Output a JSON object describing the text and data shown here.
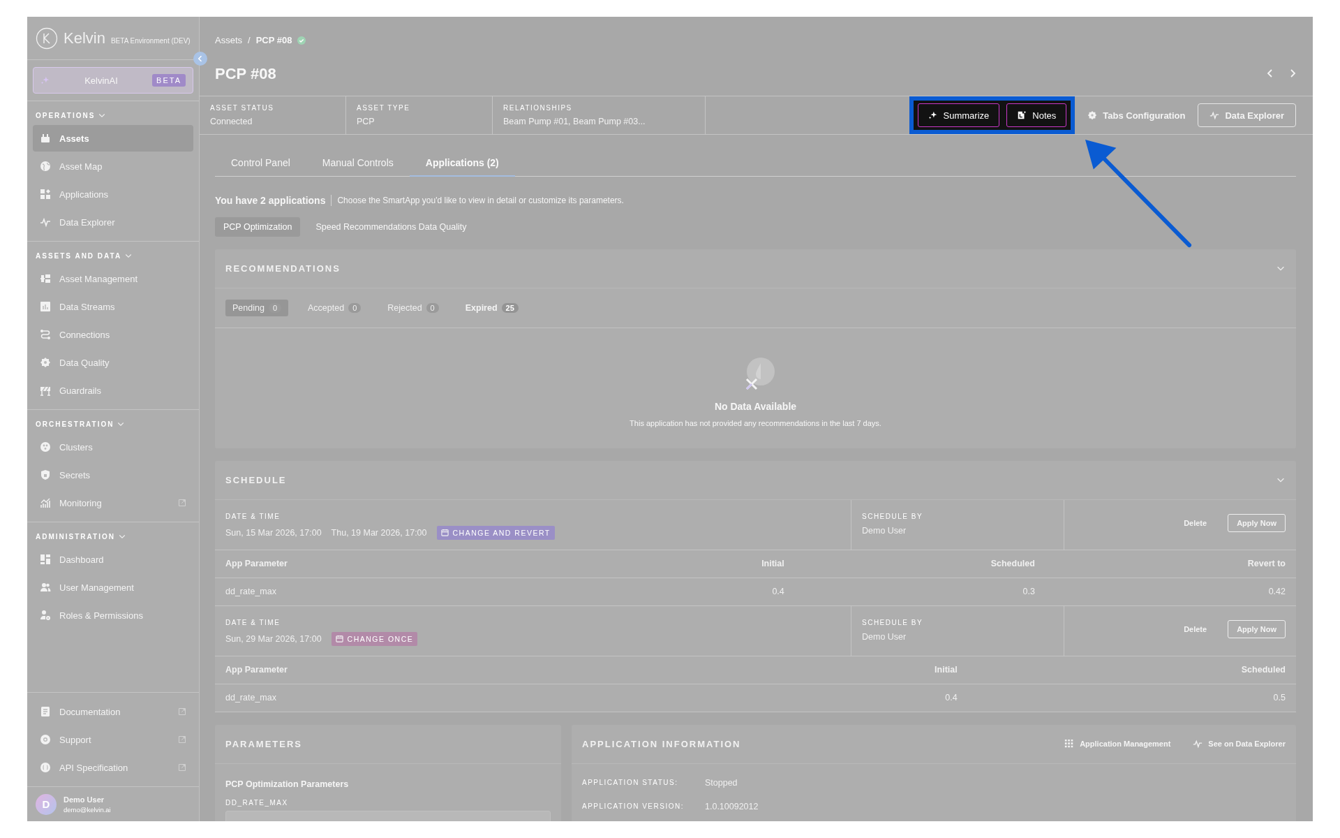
{
  "sidebar": {
    "logo": "Kelvin",
    "environment": "BETA Environment (DEV)",
    "ai_button": {
      "label": "KelvinAI",
      "badge": "BETA"
    },
    "sections": [
      {
        "title": "OPERATIONS",
        "expanded": true,
        "items": [
          {
            "label": "Assets",
            "selected": true,
            "external": false
          },
          {
            "label": "Asset Map",
            "selected": false,
            "external": false
          },
          {
            "label": "Applications",
            "selected": false,
            "external": false
          },
          {
            "label": "Data Explorer",
            "selected": false,
            "external": false
          }
        ]
      },
      {
        "title": "ASSETS AND DATA",
        "expanded": true,
        "items": [
          {
            "label": "Asset Management",
            "selected": false,
            "external": false
          },
          {
            "label": "Data Streams",
            "selected": false,
            "external": false
          },
          {
            "label": "Connections",
            "selected": false,
            "external": false
          },
          {
            "label": "Data Quality",
            "selected": false,
            "external": false
          },
          {
            "label": "Guardrails",
            "selected": false,
            "external": false
          }
        ]
      },
      {
        "title": "ORCHESTRATION",
        "expanded": true,
        "items": [
          {
            "label": "Clusters",
            "selected": false,
            "external": false
          },
          {
            "label": "Secrets",
            "selected": false,
            "external": false
          },
          {
            "label": "Monitoring",
            "selected": false,
            "external": true
          }
        ]
      },
      {
        "title": "ADMINISTRATION",
        "expanded": true,
        "items": [
          {
            "label": "Dashboard",
            "selected": false,
            "external": false
          },
          {
            "label": "User Management",
            "selected": false,
            "external": false
          },
          {
            "label": "Roles & Permissions",
            "selected": false,
            "external": false
          }
        ]
      }
    ],
    "footer_items": [
      {
        "label": "Documentation",
        "selected": false,
        "external": true
      },
      {
        "label": "Support",
        "selected": false,
        "external": true
      },
      {
        "label": "API Specification",
        "selected": false,
        "external": true
      }
    ],
    "user": {
      "initial": "D",
      "name": "Demo User",
      "email": "demo@kelvin.ai"
    }
  },
  "breadcrumb_separator": "/",
  "breadcrumb": [
    {
      "label": "Assets",
      "current": false,
      "verified": false
    },
    {
      "label": "PCP #08",
      "current": true,
      "verified": true
    }
  ],
  "title": "PCP #08",
  "info": [
    {
      "label": "ASSET STATUS",
      "value": "Connected"
    },
    {
      "label": "ASSET TYPE",
      "value": "PCP"
    },
    {
      "label": "RELATIONSHIPS",
      "value": "Beam Pump #01, Beam Pump #03..."
    }
  ],
  "actions": [
    {
      "label": "Summarize",
      "kind": "ai"
    },
    {
      "label": "Notes",
      "kind": "ai"
    },
    {
      "label": "Tabs Configuration",
      "kind": "plain"
    },
    {
      "label": "Data Explorer",
      "kind": "outline"
    }
  ],
  "tabs": [
    {
      "label": "Control Panel",
      "selected": false
    },
    {
      "label": "Manual Controls",
      "selected": false
    },
    {
      "label": "Applications (2)",
      "selected": true
    }
  ],
  "apps_intro": {
    "count": "You have 2 applications",
    "hint": "Choose the SmartApp you'd like to view in detail or customize its parameters."
  },
  "app_chips": [
    {
      "label": "PCP Optimization",
      "selected": true
    },
    {
      "label": "Speed Recommendations Data Quality",
      "selected": false
    }
  ],
  "recommendations": {
    "title": "RECOMMENDATIONS",
    "filters": [
      {
        "label": "Pending",
        "count": "0",
        "selected": true,
        "disabled": true
      },
      {
        "label": "Accepted",
        "count": "0",
        "selected": false,
        "disabled": true
      },
      {
        "label": "Rejected",
        "count": "0",
        "selected": false,
        "disabled": true
      },
      {
        "label": "Expired",
        "count": "25",
        "selected": false,
        "disabled": false
      }
    ],
    "empty_title": "No Data Available",
    "empty_text": "This application has not provided any recommendations in the last 7 days."
  },
  "schedule": {
    "title": "SCHEDULE",
    "entries": [
      {
        "date_label": "DATE & TIME",
        "dates": [
          "Sun, 15 Mar 2026, 17:00",
          "Thu, 19 Mar 2026, 17:00"
        ],
        "tag": "CHANGE AND REVERT",
        "color": "#9a8fc6",
        "by_label": "SCHEDULE BY",
        "by": "Demo User",
        "delete": "Delete",
        "apply": "Apply Now",
        "columns": [
          "App Parameter",
          "Initial",
          "Scheduled",
          "Revert to"
        ],
        "rows": [
          [
            "dd_rate_max",
            "0.4",
            "0.3",
            "0.42"
          ]
        ]
      },
      {
        "date_label": "DATE & TIME",
        "dates": [
          "Sun, 29 Mar 2026, 17:00"
        ],
        "tag": "CHANGE ONCE",
        "color": "#b28aa8",
        "by_label": "SCHEDULE BY",
        "by": "Demo User",
        "delete": "Delete",
        "apply": "Apply Now",
        "columns": [
          "App Parameter",
          "Initial",
          "Scheduled"
        ],
        "rows": [
          [
            "dd_rate_max",
            "0.4",
            "0.5"
          ]
        ]
      }
    ]
  },
  "parameters": {
    "title": "PARAMETERS",
    "group": "PCP Optimization Parameters",
    "field_label": "DD_RATE_MAX"
  },
  "app_info": {
    "title": "APPLICATION INFORMATION",
    "links": [
      "Application Management",
      "See on Data Explorer"
    ],
    "rows": [
      {
        "label": "APPLICATION STATUS:",
        "value": "Stopped"
      },
      {
        "label": "APPLICATION VERSION:",
        "value": "1.0.10092012"
      }
    ]
  }
}
